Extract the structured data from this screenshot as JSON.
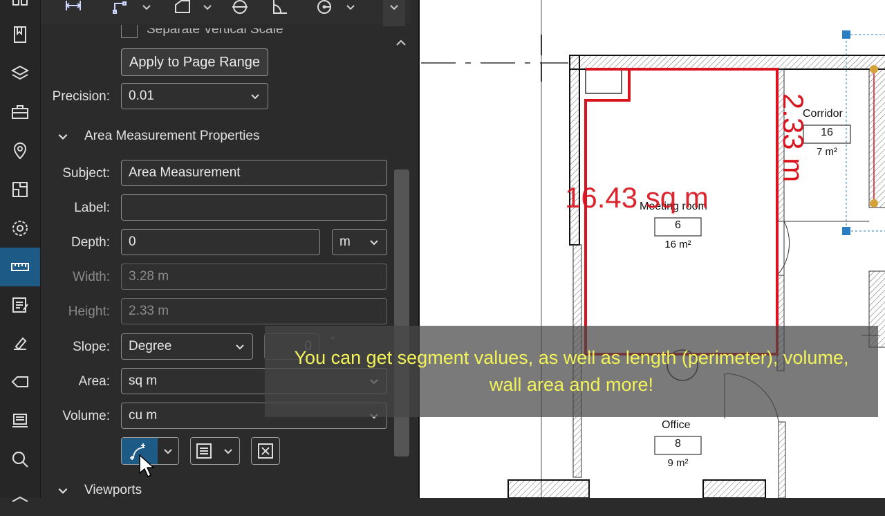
{
  "panel": {
    "separate_scale_label": "Separate Vertical Scale",
    "apply_button": "Apply to Page Range",
    "precision_label": "Precision:",
    "precision_value": "0.01",
    "section_area": "Area Measurement Properties",
    "fields": {
      "subject_label": "Subject:",
      "subject_value": "Area Measurement",
      "label_label": "Label:",
      "label_value": "",
      "depth_label": "Depth:",
      "depth_value": "0",
      "depth_unit": "m",
      "width_label": "Width:",
      "width_value": "3.28 m",
      "height_label": "Height:",
      "height_value": "2.33 m",
      "slope_label": "Slope:",
      "slope_value": "Degree",
      "slope_num": "0",
      "slope_unit": "°",
      "area_label": "Area:",
      "area_value": "sq m",
      "volume_label": "Volume:",
      "volume_value": "cu m"
    },
    "section_viewports": "Viewports"
  },
  "drawing": {
    "area_measure": "16.43 sq m",
    "height_measure": "2.33 m",
    "rooms": [
      {
        "name": "Corridor",
        "number": "16",
        "area": "7 m²"
      },
      {
        "name": "Meeting room",
        "number": "6",
        "area": "16 m²"
      },
      {
        "name": "Office",
        "number": "8",
        "area": "9 m²"
      }
    ],
    "colors": {
      "measure_red": "#d9141e",
      "selected_handle": "#2a7fc2",
      "active_rail": "#1e5a86"
    }
  },
  "caption": {
    "line1": "You can get segment values, as well as length (perimeter), volume,",
    "line2": "wall area and more!"
  }
}
